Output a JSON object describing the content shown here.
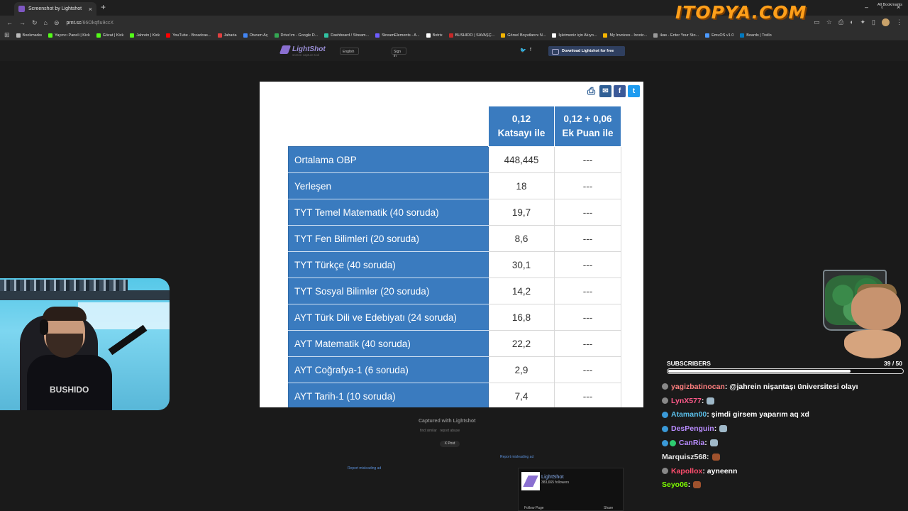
{
  "browser": {
    "tab_title": "Screenshot by Lightshot",
    "tab_close": "×",
    "new_tab": "+",
    "url_host": "prnt.sc",
    "url_path": "/66Okqfiu9ccX",
    "window_controls": [
      "–",
      "▫",
      "×"
    ],
    "bookmarks": [
      {
        "label": "Bookmarks",
        "color": "#bbbbbb"
      },
      {
        "label": "Yayıncı Paneli | Kick",
        "color": "#53fc18"
      },
      {
        "label": "Gözat | Kick",
        "color": "#53fc18"
      },
      {
        "label": "Jahrein | Kick",
        "color": "#53fc18"
      },
      {
        "label": "YouTube - Broadcas...",
        "color": "#ff0000"
      },
      {
        "label": "Jaharia",
        "color": "#e04040"
      },
      {
        "label": "Oturum Aç",
        "color": "#4285f4"
      },
      {
        "label": "Drive'ım - Google D...",
        "color": "#34a853"
      },
      {
        "label": "Dashboard / Stream...",
        "color": "#31c3a2"
      },
      {
        "label": "StreamElements - A...",
        "color": "#6d5cff"
      },
      {
        "label": "Botrix",
        "color": "#ffffff"
      },
      {
        "label": "BUSHIDO | SAVAŞÇ...",
        "color": "#c62828"
      },
      {
        "label": "Görsel Boyutlarını N...",
        "color": "#f4b400"
      },
      {
        "label": "İşletmeniz için Akıyo...",
        "color": "#ffffff"
      },
      {
        "label": "My Invoices - Invoic...",
        "color": "#f7b500"
      },
      {
        "label": "ikas - Enter Your Sto...",
        "color": "#999999"
      },
      {
        "label": "EmuOS v1.0",
        "color": "#4c9aff"
      },
      {
        "label": "Boards | Trello",
        "color": "#0079bf"
      }
    ],
    "all_bookmarks": "All Bookmarks"
  },
  "overlay_logo": "ITOPYA.COM",
  "lightshot_header": {
    "brand": "LightShot",
    "tagline": "screen capture tool",
    "language": "English",
    "signin": "Sign in",
    "twitter": "🐦",
    "facebook": "f",
    "download": "Download Lightshot for free"
  },
  "screenshot": {
    "icons": {
      "print": "⎙",
      "mail": "✉",
      "facebook": "f",
      "twitter": "t"
    },
    "col1_header": "0,12 Katsayı ile",
    "col2_header": "0,12 + 0,06 Ek Puan ile",
    "rows": [
      {
        "label": "Ortalama OBP",
        "value": "448,445",
        "extra": "---"
      },
      {
        "label": "Yerleşen",
        "value": "18",
        "extra": "---"
      },
      {
        "label": "TYT Temel Matematik (40 soruda)",
        "value": "19,7",
        "extra": "---"
      },
      {
        "label": "TYT Fen Bilimleri (20 soruda)",
        "value": "8,6",
        "extra": "---"
      },
      {
        "label": "TYT Türkçe (40 soruda)",
        "value": "30,1",
        "extra": "---"
      },
      {
        "label": "TYT Sosyal Bilimler (20 soruda)",
        "value": "14,2",
        "extra": "---"
      },
      {
        "label": "AYT Türk Dili ve Edebiyatı (24 soruda)",
        "value": "16,8",
        "extra": "---"
      },
      {
        "label": "AYT Matematik (40 soruda)",
        "value": "22,2",
        "extra": "---"
      },
      {
        "label": "AYT Coğrafya-1 (6 soruda)",
        "value": "2,9",
        "extra": "---"
      },
      {
        "label": "AYT Tarih-1 (10 soruda)",
        "value": "7,4",
        "extra": "---"
      }
    ]
  },
  "below": {
    "captured": "Captured with Lightshot",
    "find_similar": "find similar",
    "report_abuse": "report abuse",
    "x_post": "X Post",
    "report_ad_1": "Report misleading ad",
    "report_ad_2": "Report misleading ad",
    "fb_name": "LightShot",
    "fb_followers": "383,665 followers",
    "fb_follow": "Follow Page",
    "fb_share": "Share"
  },
  "webcam": {
    "shirt_text": "BUSHIDO"
  },
  "subscribers": {
    "label": "SUBSCRIBERS",
    "count": "39 / 50",
    "current": 39,
    "goal": 50
  },
  "chat": [
    {
      "user": "yagizbatinocan",
      "color": "#ff7f7f",
      "badges": [
        "#888888"
      ],
      "text": ": @jahrein nişantaşı üniversitesi olayı",
      "emote": ""
    },
    {
      "user": "LynX577",
      "color": "#ff5a8a",
      "badges": [
        "#888888"
      ],
      "text": " :",
      "emote": "#9fb8c8"
    },
    {
      "user": "Ataman00",
      "color": "#5bc0eb",
      "badges": [
        "#3a9ad9"
      ],
      "text": ": şimdi girsem yaparım aq xd",
      "emote": ""
    },
    {
      "user": "DesPenguin",
      "color": "#b98cff",
      "badges": [
        "#3a9ad9"
      ],
      "text": " :",
      "emote": "#9fb8c8"
    },
    {
      "user": "CanRia",
      "color": "#b98cff",
      "badges": [
        "#3a9ad9",
        "#2ecc71"
      ],
      "text": " :",
      "emote": "#9fb8c8"
    },
    {
      "user": "Marquisz568",
      "color": "#e8e8e8",
      "badges": [],
      "text": " :",
      "emote": "#a0522d"
    },
    {
      "user": "Kapollox",
      "color": "#ff4d6d",
      "badges": [
        "#888888"
      ],
      "text": ": ayneenn",
      "emote": ""
    },
    {
      "user": "Seyo06",
      "color": "#7cfc00",
      "badges": [],
      "text": " :",
      "emote": "#a0522d"
    }
  ]
}
